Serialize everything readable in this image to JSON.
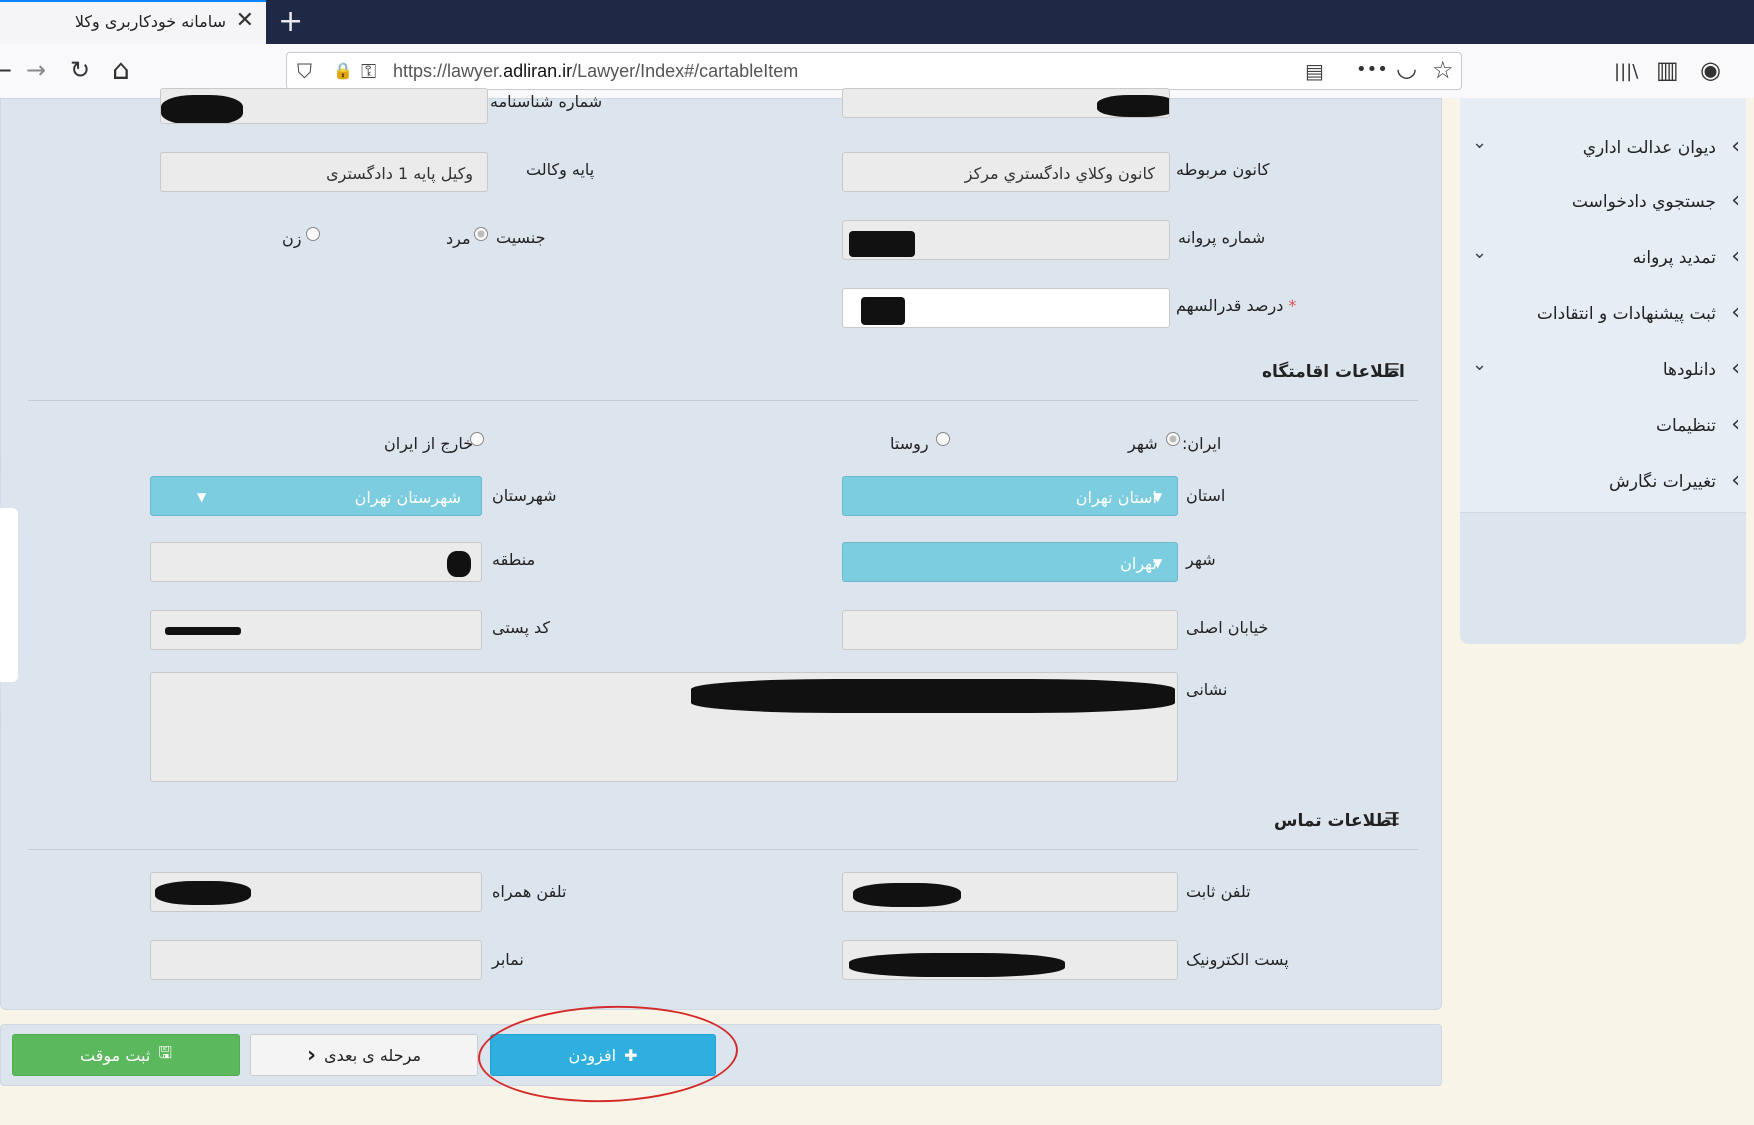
{
  "browser": {
    "tab_title": "سامانه خودکاربری وکلا",
    "tab_close": "✕",
    "new_tab": "+",
    "url_prefix": "https://lawyer.",
    "url_host": "adliran.ir",
    "url_path": "/Lawyer/Index#/cartableItem",
    "icons": {
      "back": "←",
      "forward": "→",
      "reload": "↻",
      "home": "⌂",
      "shield": "⛉",
      "lock": "🔒",
      "key": "⚿",
      "reader": "▤",
      "more": "•••",
      "pocket": "◡",
      "star": "☆",
      "library": "|||\\",
      "sidebar": "▥",
      "account": "◉"
    }
  },
  "sidebar": {
    "items": [
      {
        "label": "ديوان عدالت اداري",
        "has_submenu": true
      },
      {
        "label": "جستجوي دادخواست",
        "has_submenu": false
      },
      {
        "label": "تمديد پروانه",
        "has_submenu": true
      },
      {
        "label": "ثبت پيشنهادات و انتقادات",
        "has_submenu": false
      },
      {
        "label": "دانلودها",
        "has_submenu": true
      },
      {
        "label": "تنظيمات",
        "has_submenu": false
      },
      {
        "label": "تغييرات نگارش",
        "has_submenu": false
      }
    ],
    "chev_left": "‹",
    "chev_down": "⌄"
  },
  "form": {
    "personal": {
      "id_number_label": "شماره شناسنامه",
      "license_base_label": "پایه وکالت",
      "license_base_value": "وکیل پایه 1 دادگستری",
      "bar_label": "کانون مربوطه",
      "bar_value": "كانون وكلاي دادگستري مركز",
      "gender_label": "جنسیت",
      "gender_male": "مرد",
      "gender_female": "زن",
      "license_number_label": "شماره پروانه",
      "share_percent_label": "درصد قدرالسهم",
      "required_mark": "*"
    },
    "residence": {
      "title": "اطلاعات اقامتگاه",
      "iran_label": "ایران:",
      "city_option": "شهر",
      "village_option": "روستا",
      "abroad_option": "خارج از ایران",
      "province_label": "استان",
      "province_value": "استان تهران",
      "county_label": "شهرستان",
      "county_value": "شهرستان تهران",
      "city_label": "شهر",
      "city_value": "تهران",
      "district_label": "منطقه",
      "main_street_label": "خیابان اصلی",
      "postal_code_label": "کد پستی",
      "address_label": "نشانی"
    },
    "contact": {
      "title": "اطلاعات تماس",
      "phone_label": "تلفن ثابت",
      "mobile_label": "تلفن همراه",
      "email_label": "پست الکترونیک",
      "fax_label": "نمابر"
    },
    "caret": "▼",
    "list_icon": "☰"
  },
  "actions": {
    "save_temp": "ثبت موقت",
    "save_icon": "🖫",
    "next_step": "مرحله ی بعدی",
    "next_icon": "‹",
    "add": "افزودن",
    "add_icon": "✚"
  }
}
